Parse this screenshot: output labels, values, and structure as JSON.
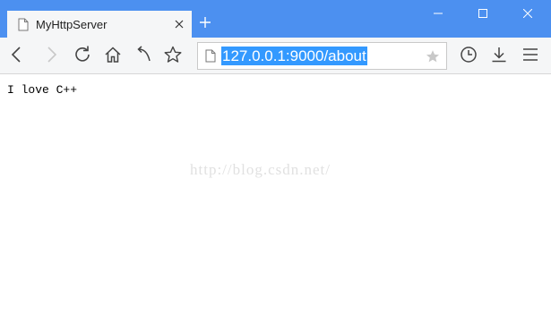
{
  "tab": {
    "title": "MyHttpServer",
    "page_icon": "page-icon",
    "close_icon": "close-icon"
  },
  "new_tab": {
    "icon": "plus-icon"
  },
  "window_controls": [
    "minimize-icon",
    "maximize-icon",
    "close-icon"
  ],
  "toolbar": {
    "buttons": [
      "back-icon",
      "forward-icon",
      "reload-icon",
      "home-icon",
      "undo-icon",
      "star-icon"
    ],
    "right_buttons": [
      "history-icon",
      "download-icon",
      "menu-icon"
    ]
  },
  "address_bar": {
    "url": "127.0.0.1:9000/about",
    "selected": true,
    "bookmark_icon": "star-filled-icon"
  },
  "page": {
    "body_text": "I love C++",
    "watermark": "http://blog.csdn.net/"
  },
  "colors": {
    "titlebar": "#4c90f0",
    "tab_background": "#f5f6f7",
    "selection": "#3399ff",
    "forward_disabled": "#c8c8c8",
    "icon": "#444444"
  }
}
